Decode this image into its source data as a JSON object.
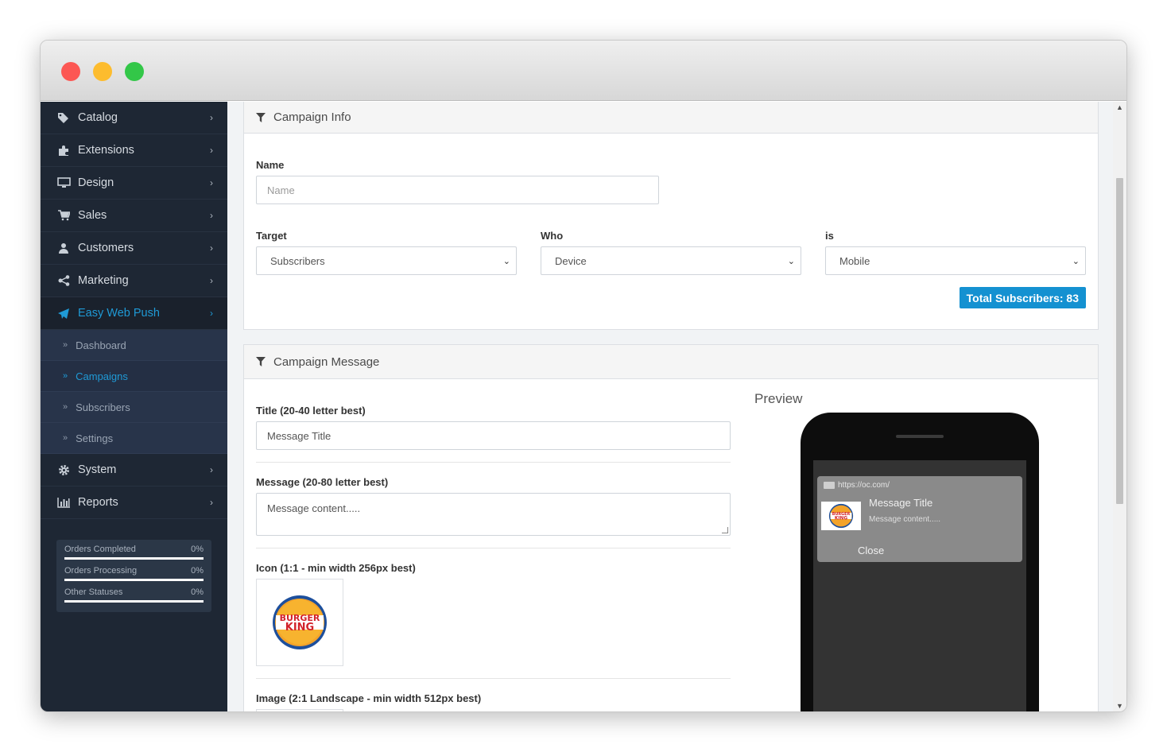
{
  "sidebar": {
    "items": [
      {
        "label": "Catalog",
        "icon": "tags-icon"
      },
      {
        "label": "Extensions",
        "icon": "puzzle-icon"
      },
      {
        "label": "Design",
        "icon": "monitor-icon"
      },
      {
        "label": "Sales",
        "icon": "cart-icon"
      },
      {
        "label": "Customers",
        "icon": "user-icon"
      },
      {
        "label": "Marketing",
        "icon": "share-icon"
      },
      {
        "label": "Easy Web Push",
        "icon": "paper-plane-icon"
      }
    ],
    "subitems": [
      "Dashboard",
      "Campaigns",
      "Subscribers",
      "Settings"
    ],
    "after_items": [
      {
        "label": "System",
        "icon": "gear-icon"
      },
      {
        "label": "Reports",
        "icon": "bar-chart-icon"
      }
    ],
    "stats": [
      {
        "label": "Orders Completed",
        "value": "0%"
      },
      {
        "label": "Orders Processing",
        "value": "0%"
      },
      {
        "label": "Other Statuses",
        "value": "0%"
      }
    ]
  },
  "campaign_info": {
    "heading": "Campaign Info",
    "name_label": "Name",
    "name_placeholder": "Name",
    "target_label": "Target",
    "target_value": "Subscribers",
    "who_label": "Who",
    "who_value": "Device",
    "is_label": "is",
    "is_value": "Mobile",
    "total_button": "Total Subscribers: 83"
  },
  "campaign_message": {
    "heading": "Campaign Message",
    "title_label": "Title (20-40 letter best)",
    "title_value": "Message Title",
    "message_label": "Message (20-80 letter best)",
    "message_value": "Message content.....",
    "icon_label": "Icon (1:1 - min width 256px best)",
    "image_label": "Image (2:1 Landscape - min width 512px best)"
  },
  "preview": {
    "heading": "Preview",
    "url": "https://oc.com/",
    "title": "Message Title",
    "message": "Message content.....",
    "close": "Close"
  },
  "colors": {
    "sidebar_bg": "#1e2734",
    "accent": "#1f9ad6",
    "button": "#1491d1"
  }
}
